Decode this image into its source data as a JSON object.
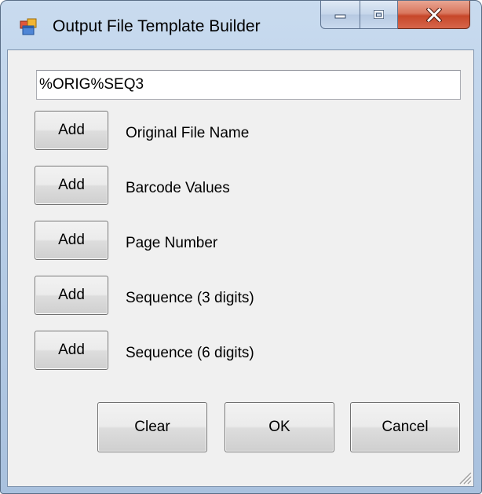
{
  "window": {
    "title": "Output File Template Builder",
    "icon": "app-window-icon",
    "caption_buttons": [
      "minimize-icon",
      "maximize-icon",
      "close-icon"
    ]
  },
  "template_field": {
    "value": "%ORIG%SEQ3"
  },
  "rows": [
    {
      "button_label": "Add",
      "label": "Original File Name"
    },
    {
      "button_label": "Add",
      "label": "Barcode Values"
    },
    {
      "button_label": "Add",
      "label": "Page Number"
    },
    {
      "button_label": "Add",
      "label": "Sequence (3 digits)"
    },
    {
      "button_label": "Add",
      "label": "Sequence (6 digits)"
    }
  ],
  "footer": {
    "clear_label": "Clear",
    "ok_label": "OK",
    "cancel_label": "Cancel"
  },
  "colors": {
    "frame": "#b7cde6",
    "client": "#f0f0f0",
    "close_button": "#c7472a"
  }
}
